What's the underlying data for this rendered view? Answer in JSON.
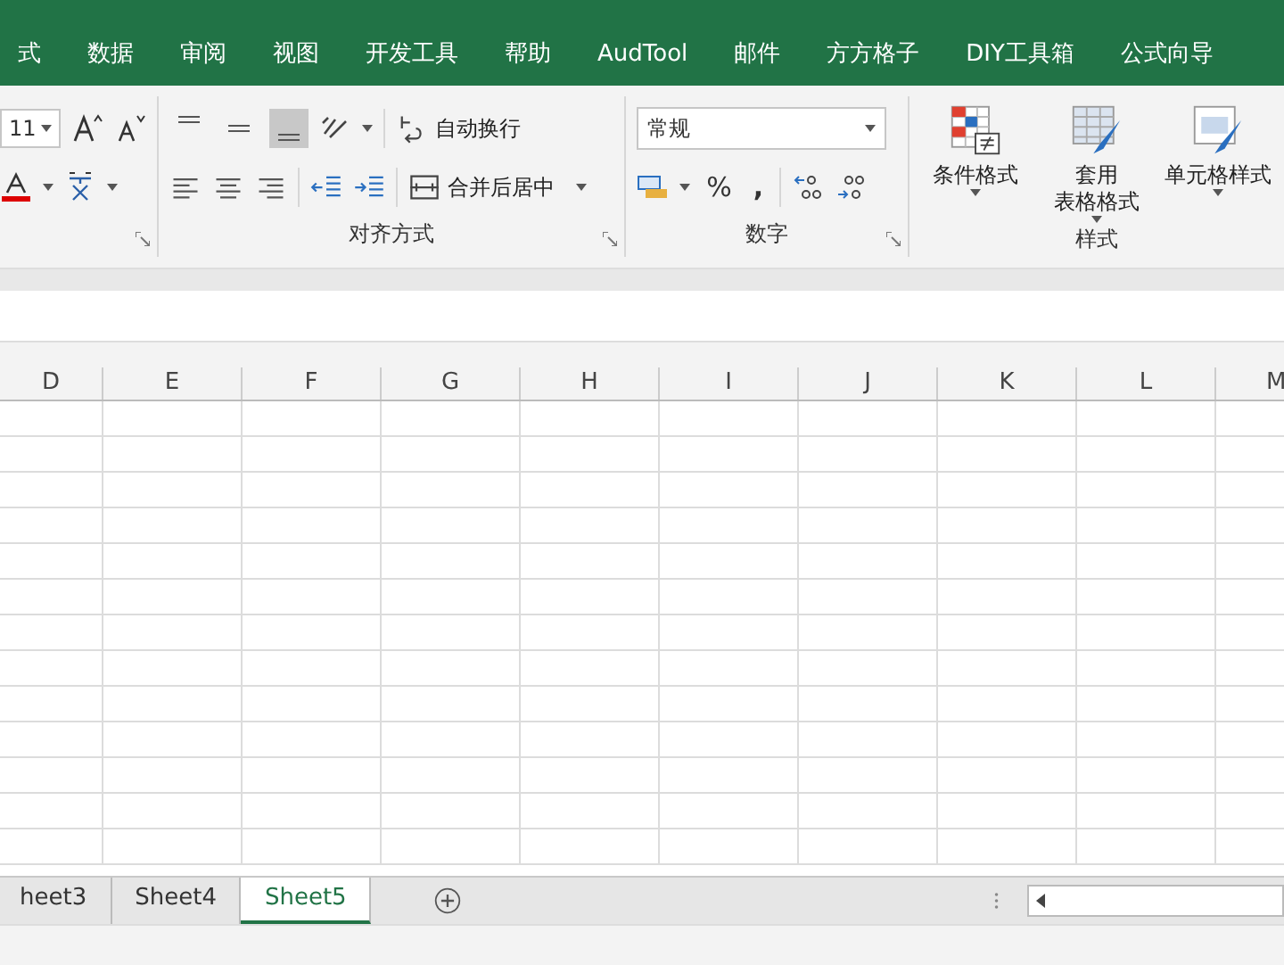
{
  "menu_tabs": [
    {
      "label": "式",
      "selected": false
    },
    {
      "label": "数据",
      "selected": false
    },
    {
      "label": "审阅",
      "selected": false
    },
    {
      "label": "视图",
      "selected": false
    },
    {
      "label": "开发工具",
      "selected": false
    },
    {
      "label": "帮助",
      "selected": false
    },
    {
      "label": "AudTool",
      "selected": false
    },
    {
      "label": "邮件",
      "selected": false
    },
    {
      "label": "方方格子",
      "selected": false
    },
    {
      "label": "DIY工具箱",
      "selected": false
    },
    {
      "label": "公式向导",
      "selected": false
    }
  ],
  "font": {
    "size": "11"
  },
  "alignment": {
    "vertical_align": [
      {
        "selected": false
      },
      {
        "selected": false
      },
      {
        "selected": true
      }
    ],
    "wrap_text": "自动换行",
    "merge": "合并后居中",
    "label": "对齐方式"
  },
  "number": {
    "format": "常规",
    "percent": "%",
    "comma": ",",
    "label": "数字"
  },
  "styles": {
    "buttons": [
      {
        "kind": "conditional",
        "lines": [
          "条件格式"
        ]
      },
      {
        "kind": "table",
        "lines": [
          "套用",
          "表格格式"
        ]
      },
      {
        "kind": "cell",
        "lines": [
          "单元格样式"
        ]
      }
    ],
    "label": "样式"
  },
  "columns": [
    "D",
    "E",
    "F",
    "G",
    "H",
    "I",
    "J",
    "K",
    "L",
    "M"
  ],
  "sheet_tabs": [
    {
      "label": "heet3",
      "selected": false
    },
    {
      "label": "Sheet4",
      "selected": false
    },
    {
      "label": "Sheet5",
      "selected": true
    }
  ]
}
